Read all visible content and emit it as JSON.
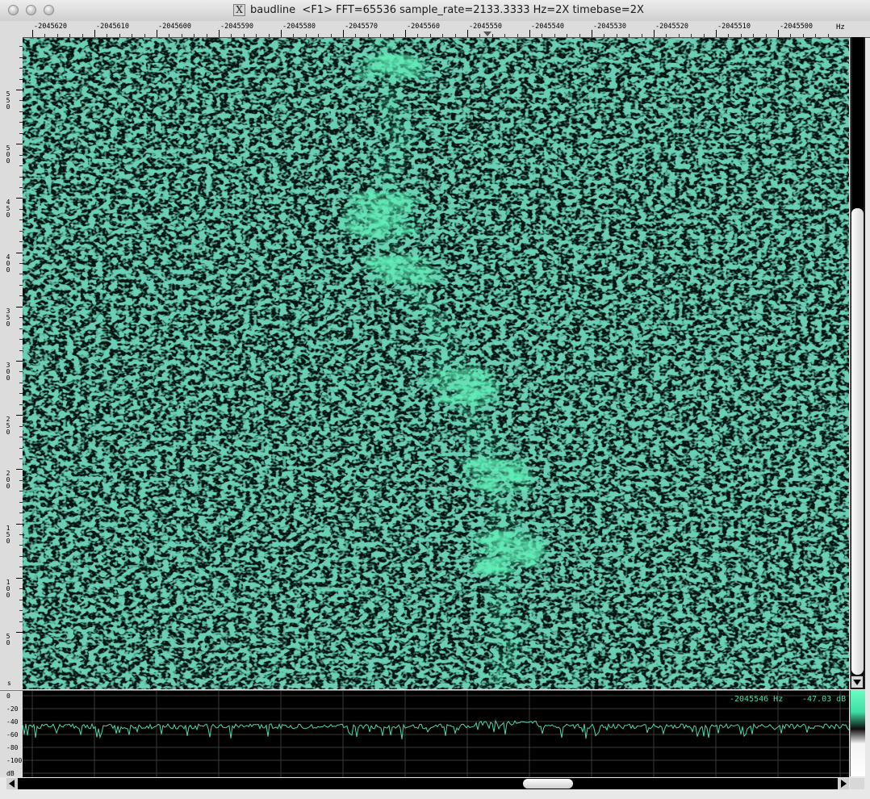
{
  "window": {
    "app_name": "baudline",
    "title": "baudline  <F1> FFT=65536 sample_rate=2133.3333 Hz=2X timebase=2X",
    "close_icon": "close-icon",
    "minimize_icon": "minimize-icon",
    "zoom_icon": "zoom-icon",
    "app_icon_glyph": "X"
  },
  "freq_axis": {
    "unit": "Hz",
    "ticks": [
      "-2045620",
      "-2045610",
      "-2045600",
      "-2045590",
      "-2045580",
      "-2045570",
      "-2045560",
      "-2045550",
      "-2045540",
      "-2045530",
      "-2045520",
      "-2045510",
      "-2045500"
    ]
  },
  "time_axis": {
    "unit": "s",
    "ticks": [
      "550",
      "500",
      "450",
      "400",
      "350",
      "300",
      "250",
      "200",
      "150",
      "100",
      "50"
    ]
  },
  "spectrum": {
    "db_ticks": [
      "0",
      "-20",
      "-40",
      "-60",
      "-80",
      "-100",
      "dB"
    ],
    "cursor_freq": "-2045546 Hz",
    "cursor_level": "-47.03 dB",
    "trace_color": "#4fd8a6"
  },
  "colors": {
    "waterfall_base": "#061a12",
    "signal": "#5ff0b8",
    "noise": "#1d7a57"
  }
}
